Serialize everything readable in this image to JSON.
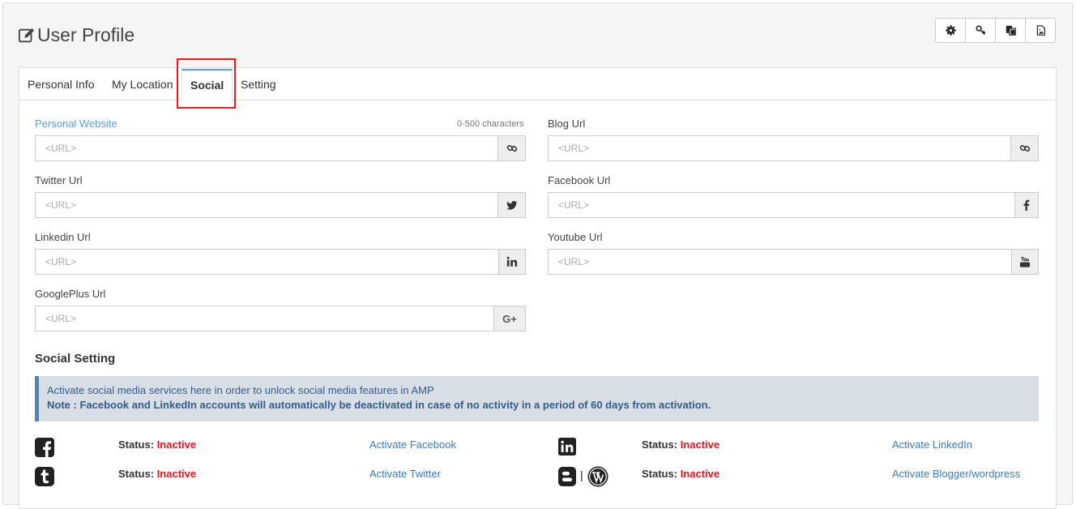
{
  "page": {
    "title": "User Profile"
  },
  "toolbar": [
    {
      "name": "settings-button",
      "icon": "gear-icon"
    },
    {
      "name": "key-button",
      "icon": "key-icon"
    },
    {
      "name": "copy-button",
      "icon": "copy-icon"
    },
    {
      "name": "image-button",
      "icon": "image-icon"
    }
  ],
  "tabs": {
    "personal_info": "Personal Info",
    "my_location": "My Location",
    "social": "Social",
    "setting": "Setting"
  },
  "fields": {
    "personal_website": {
      "label": "Personal Website",
      "hint": "0-500 characters",
      "placeholder": "<URL>",
      "icon": "link-icon"
    },
    "blog_url": {
      "label": "Blog Url",
      "placeholder": "<URL>",
      "icon": "link-icon"
    },
    "twitter_url": {
      "label": "Twitter Url",
      "placeholder": "<URL>",
      "icon": "twitter-icon"
    },
    "facebook_url": {
      "label": "Facebook Url",
      "placeholder": "<URL>",
      "icon": "facebook-icon"
    },
    "linkedin_url": {
      "label": "Linkedin Url",
      "placeholder": "<URL>",
      "icon": "linkedin-icon"
    },
    "youtube_url": {
      "label": "Youtube Url",
      "placeholder": "<URL>",
      "icon": "youtube-icon"
    },
    "googleplus_url": {
      "label": "GooglePlus Url",
      "placeholder": "<URL>",
      "icon": "google-plus-icon",
      "addon_text": "G+"
    }
  },
  "social_setting": {
    "title": "Social Setting",
    "note_line1": "Activate social media services here in order to unlock social media features in AMP",
    "note_line2": "Note : Facebook and LinkedIn accounts will automatically be deactivated in case of no activity in a period of 60 days from activation.",
    "status_label": "Status:",
    "services": {
      "facebook": {
        "status": "Inactive",
        "link": "Activate Facebook"
      },
      "linkedin": {
        "status": "Inactive",
        "link": "Activate LinkedIn"
      },
      "twitter": {
        "status": "Inactive",
        "link": "Activate Twitter"
      },
      "blogger": {
        "status": "Inactive",
        "link": "Activate Blogger/wordpress",
        "separator": "|"
      }
    }
  },
  "colors": {
    "accent": "#5aa0d0",
    "link": "#3d7ab5",
    "inactive": "#d9181e",
    "highlight": "#e02020"
  }
}
